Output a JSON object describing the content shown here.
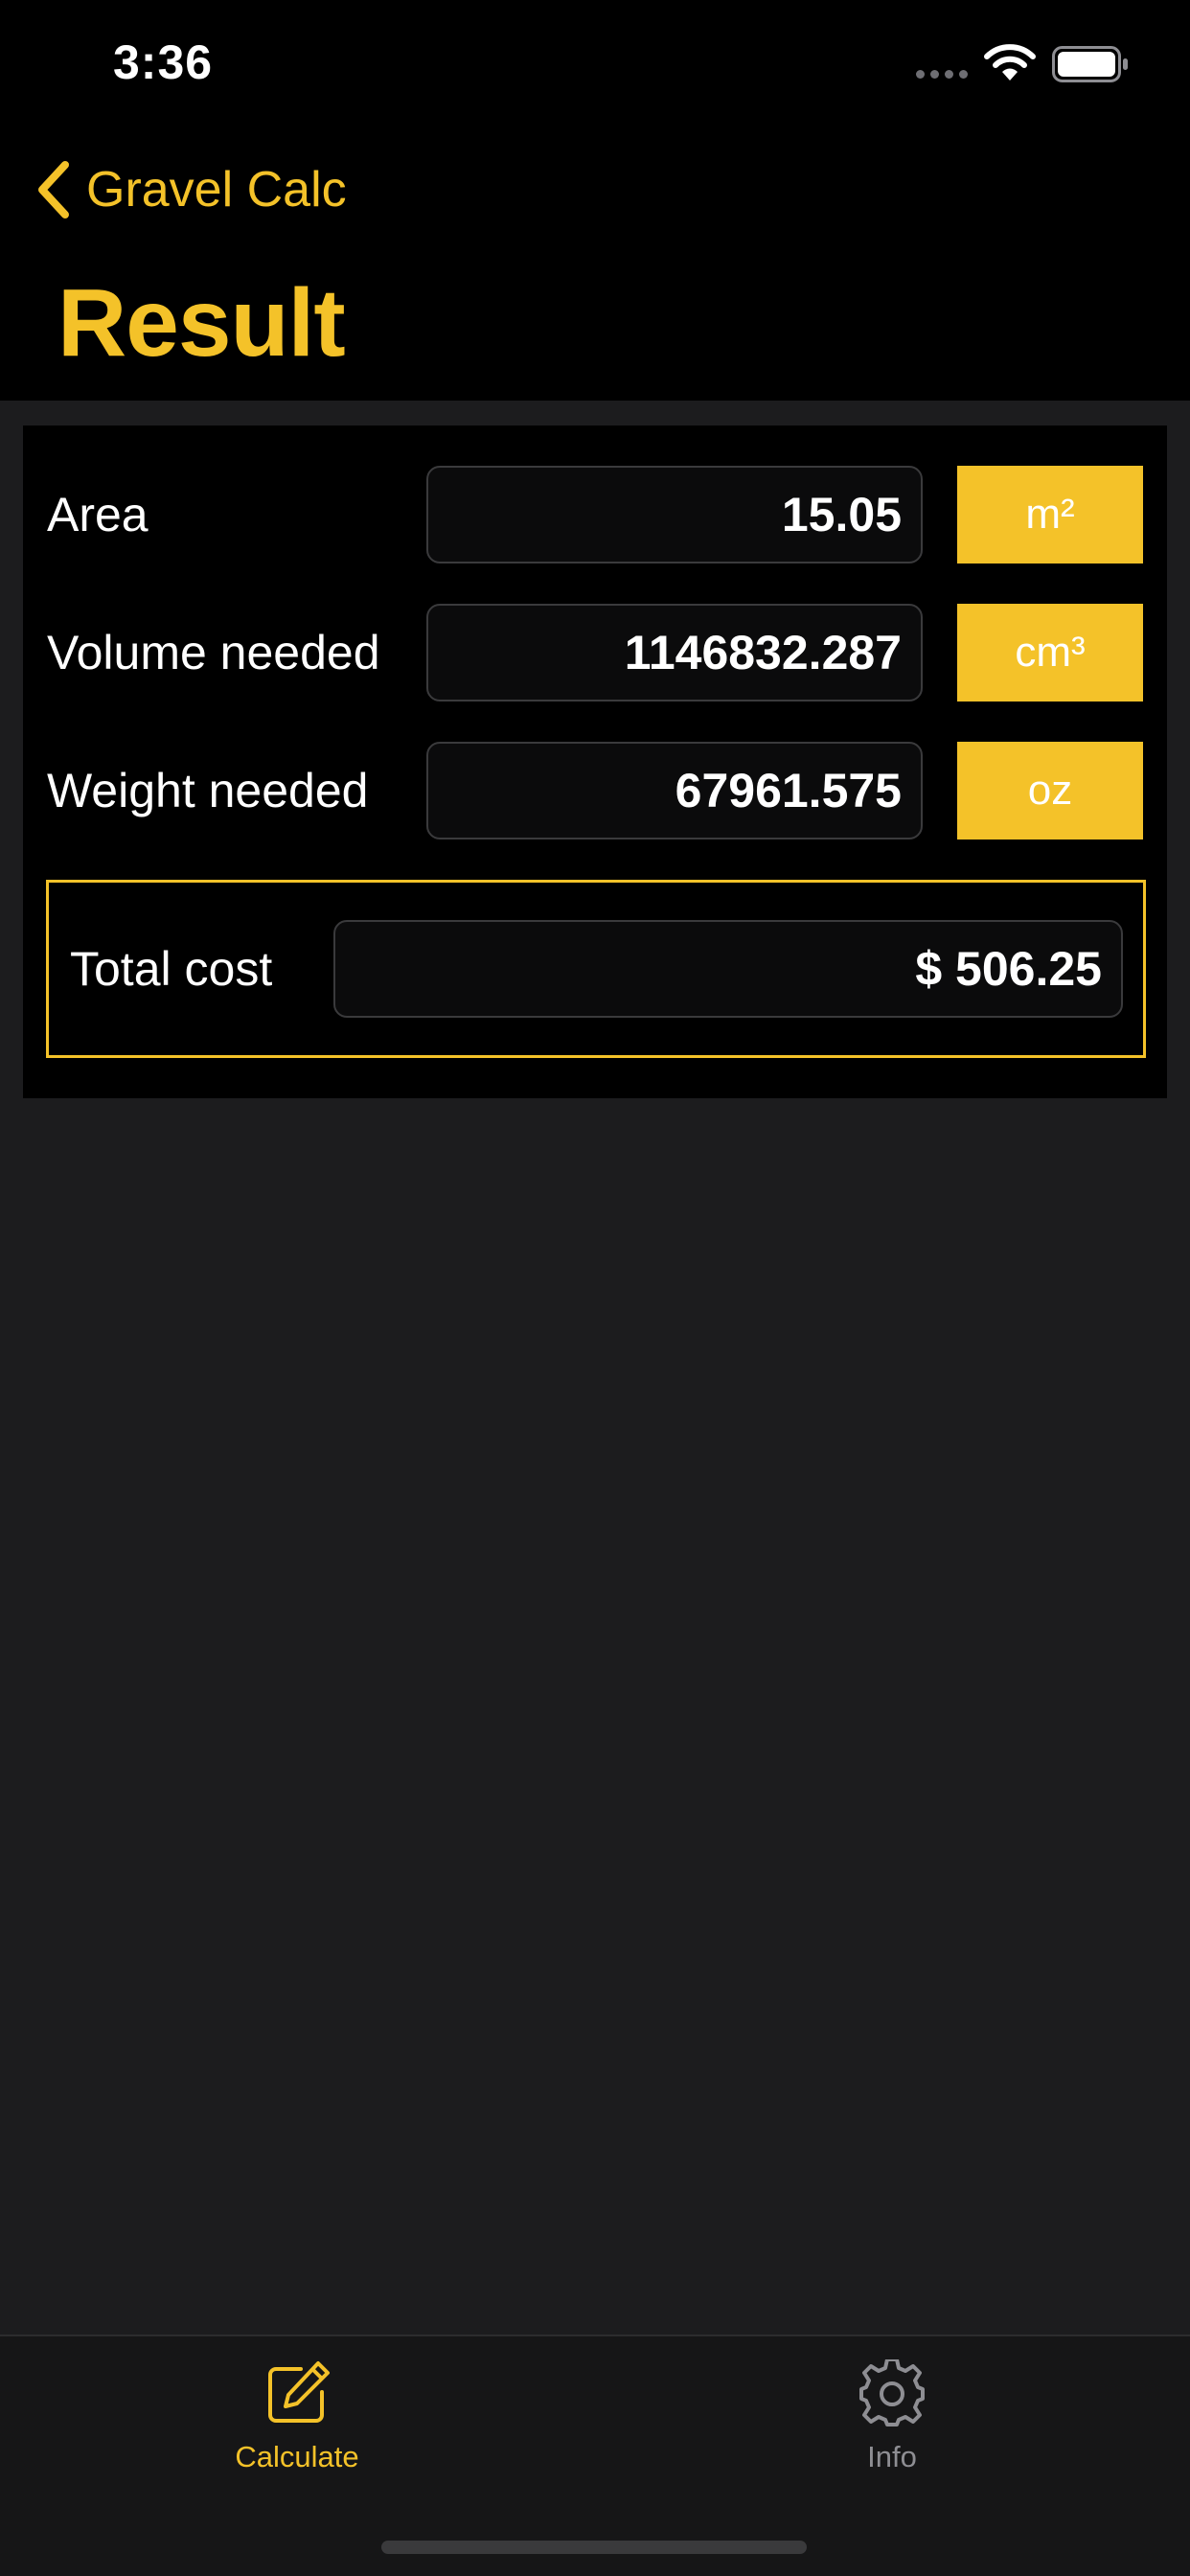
{
  "status_bar": {
    "time": "3:36"
  },
  "nav": {
    "back_label": "Gravel Calc",
    "title": "Result"
  },
  "rows": [
    {
      "label": "Area",
      "value": "15.05",
      "unit": "m²"
    },
    {
      "label": "Volume needed",
      "value": "1146832.287",
      "unit": "cm³"
    },
    {
      "label": "Weight needed",
      "value": "67961.575",
      "unit": "oz"
    }
  ],
  "total": {
    "label": "Total cost",
    "value": "$ 506.25"
  },
  "tabs": [
    {
      "label": "Calculate",
      "icon": "pencil-square-icon",
      "active": true
    },
    {
      "label": "Info",
      "icon": "gear-icon",
      "active": false
    }
  ],
  "colors": {
    "accent": "#f4c229",
    "background": "#1c1c1e",
    "panel": "#000000",
    "inactive_tab": "#8e8e93"
  }
}
